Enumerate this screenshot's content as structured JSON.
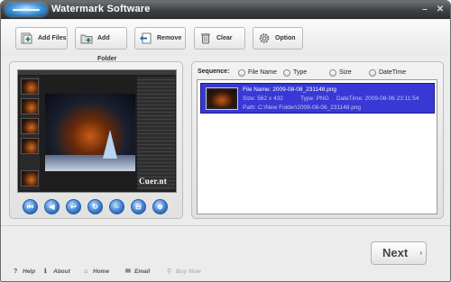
{
  "window": {
    "title": "Watermark Software"
  },
  "toolbar": {
    "add_files": "Add Files",
    "add_folder": "Add Folder",
    "remove": "Remove",
    "clear": "Clear",
    "option": "Option"
  },
  "preview": {
    "logo_text": "Cuer.nt"
  },
  "sequence": {
    "label": "Sequence:",
    "options": [
      "File Name",
      "Type",
      "Size",
      "DateTime"
    ]
  },
  "files": [
    {
      "name_line": "File Name: 2009-08-08_231148.png",
      "size_line": "Size: 562 x 432",
      "type_line": "Type: PNG",
      "datetime_line": "DateTime: 2009-08-06 23:11:54",
      "path_line": "Path: C:\\New Folder\\2009-08-06_231148.png"
    }
  ],
  "next": {
    "label": "Next"
  },
  "footer": {
    "help": "Help",
    "about": "About",
    "home": "Home",
    "email": "Email",
    "buy_now": "Buy Now"
  },
  "icons": {
    "nav": [
      "first-icon",
      "previous-icon",
      "back-icon",
      "rotate-icon",
      "fit-icon",
      "actual-size-icon",
      "zoom-icon"
    ]
  },
  "colors": {
    "selection": "#3838d6",
    "titlebar": "#3e4246",
    "nav_button": "#3d7fd0"
  }
}
